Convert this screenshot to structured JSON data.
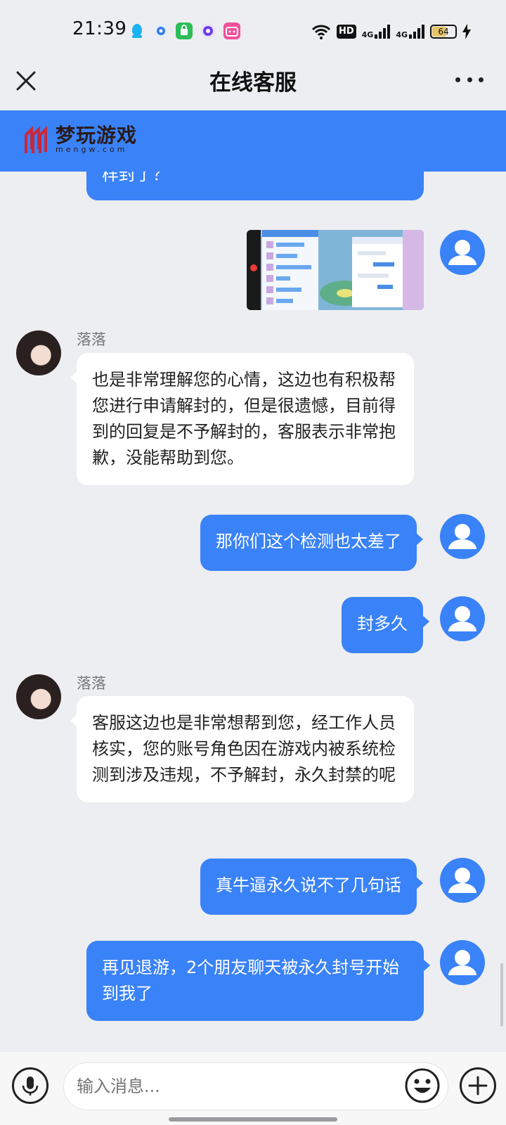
{
  "status_bar": {
    "time": "21:39",
    "network_badge": "HD",
    "signal_label_1": "4G",
    "signal_label_2": "4G",
    "battery": "64"
  },
  "header": {
    "title": "在线客服",
    "close_icon": "close-icon",
    "more_icon": "more-icon"
  },
  "brand": {
    "name": "梦玩游戏",
    "domain": "mengw.com"
  },
  "messages": [
    {
      "role": "user",
      "text": "样封了？",
      "partial": true
    },
    {
      "role": "user",
      "type": "image"
    },
    {
      "role": "agent",
      "name": "落落",
      "text": "也是非常理解您的心情，这边也有积极帮您进行申请解封的，但是很遗憾，目前得到的回复是不予解封的，客服表示非常抱歉，没能帮助到您。"
    },
    {
      "role": "user",
      "text": "那你们这个检测也太差了"
    },
    {
      "role": "user",
      "text": "封多久"
    },
    {
      "role": "agent",
      "name": "落落",
      "text": "客服这边也是非常想帮到您，经工作人员核实，您的账号角色因在游戏内被系统检测到涉及违规，不予解封，永久封禁的呢"
    },
    {
      "role": "user",
      "text": "真牛逼永久说不了几句话"
    },
    {
      "role": "user",
      "text": "再见退游，2个朋友聊天被永久封号开始到我了"
    }
  ],
  "input": {
    "placeholder": "输入消息..."
  },
  "colors": {
    "accent": "#3A82F7",
    "background": "#EDEEF1",
    "agent_bubble": "#FFFFFF"
  }
}
